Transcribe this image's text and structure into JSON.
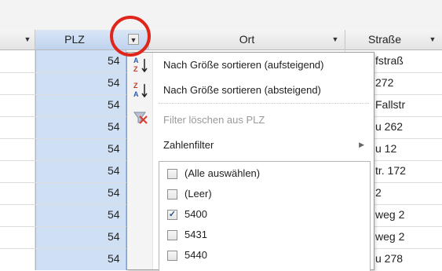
{
  "header": {
    "columns": [
      {
        "label": "PLZ"
      },
      {
        "label": "Ort"
      },
      {
        "label": "Straße"
      }
    ]
  },
  "rows": [
    {
      "plz": "54",
      "strasse": "fstraß"
    },
    {
      "plz": "54",
      "strasse": "272"
    },
    {
      "plz": "54",
      "strasse": "Fallstr"
    },
    {
      "plz": "54",
      "strasse": "u 262"
    },
    {
      "plz": "54",
      "strasse": "u 12"
    },
    {
      "plz": "54",
      "strasse": "tr. 172"
    },
    {
      "plz": "54",
      "strasse": "2"
    },
    {
      "plz": "54",
      "strasse": "weg 2"
    },
    {
      "plz": "54",
      "strasse": "weg 2"
    },
    {
      "plz": "54",
      "strasse": "u 278"
    }
  ],
  "menu": {
    "sort_asc": "Nach Größe sortieren (aufsteigend)",
    "sort_desc": "Nach Größe sortieren (absteigend)",
    "clear_filter": "Filter löschen aus PLZ",
    "number_filter": "Zahlenfilter",
    "checklist": [
      {
        "label": "(Alle auswählen)",
        "checked": false
      },
      {
        "label": "(Leer)",
        "checked": false
      },
      {
        "label": "5400",
        "checked": true
      },
      {
        "label": "5431",
        "checked": false
      },
      {
        "label": "5440",
        "checked": false
      }
    ]
  },
  "icons": {
    "dropdown": "chevron-down-icon",
    "sort_asc": "sort-ascending-icon",
    "sort_desc": "sort-descending-icon",
    "clear_filter": "clear-filter-icon",
    "submenu": "chevron-right-icon",
    "check": "checkmark-icon"
  },
  "colors": {
    "selected_column": "#cfe0f5",
    "highlight_circle": "#e0261b",
    "sort_icon_red": "#c0392b",
    "sort_icon_blue": "#2b5ca8"
  }
}
